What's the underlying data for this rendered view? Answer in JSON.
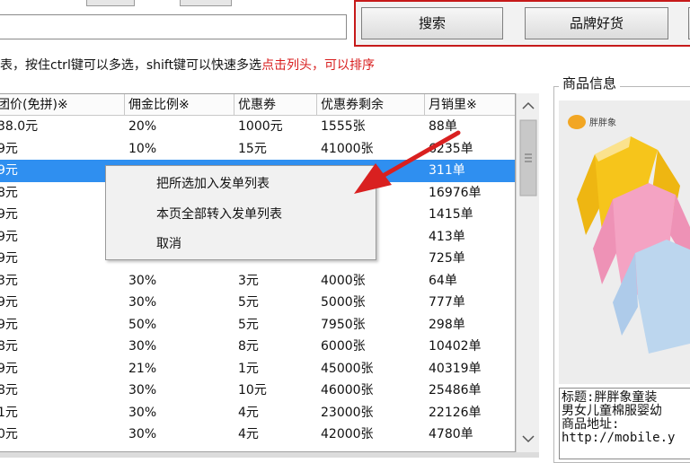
{
  "search": {
    "value": ""
  },
  "toolbar": {
    "search_label": "搜索",
    "brand_label": "品牌好货"
  },
  "hint": {
    "text": "表，按住ctrl键可以多选，shift键可以快速多选",
    "red_text": "点击列头，可以排序"
  },
  "table": {
    "headers": [
      "团价(免拼)※",
      "佣金比例※",
      "优惠券",
      "优惠券剩余",
      "月销里※"
    ],
    "selected_row": 2,
    "rows": [
      [
        "38.0元",
        "20%",
        "1000元",
        "1555张",
        "88单"
      ],
      [
        "9元",
        "10%",
        "15元",
        "41000张",
        "6235单"
      ],
      [
        "9元",
        "",
        "",
        "",
        "311单"
      ],
      [
        "8元",
        "",
        "",
        "",
        "16976单"
      ],
      [
        "9元",
        "",
        "",
        "",
        "1415单"
      ],
      [
        "9元",
        "",
        "",
        "",
        "413单"
      ],
      [
        "9元",
        "",
        "",
        "",
        "725单"
      ],
      [
        "3元",
        "30%",
        "3元",
        "4000张",
        "64单"
      ],
      [
        "9元",
        "30%",
        "5元",
        "5000张",
        "777单"
      ],
      [
        "9元",
        "50%",
        "5元",
        "7950张",
        "298单"
      ],
      [
        "8元",
        "30%",
        "8元",
        "6000张",
        "10402单"
      ],
      [
        "9元",
        "21%",
        "1元",
        "45000张",
        "40319单"
      ],
      [
        "8元",
        "30%",
        "10元",
        "46000张",
        "25486单"
      ],
      [
        "1元",
        "30%",
        "4元",
        "23000张",
        "22126单"
      ],
      [
        "0元",
        "30%",
        "4元",
        "42000张",
        "4780单"
      ]
    ]
  },
  "context_menu": {
    "items": [
      "把所选加入发单列表",
      "本页全部转入发单列表",
      "取消"
    ]
  },
  "product": {
    "group_title": "商品信息",
    "brand_logo_text": "胖胖象",
    "info_lines": [
      "标题:胖胖象童装",
      "男女儿童棉服婴幼",
      "商品地址:",
      "http://mobile.y"
    ]
  },
  "colors": {
    "accent": "#c61a1a",
    "selection": "#2f8ff0",
    "hint_red": "#d81e1e",
    "arrow": "#d92020"
  }
}
